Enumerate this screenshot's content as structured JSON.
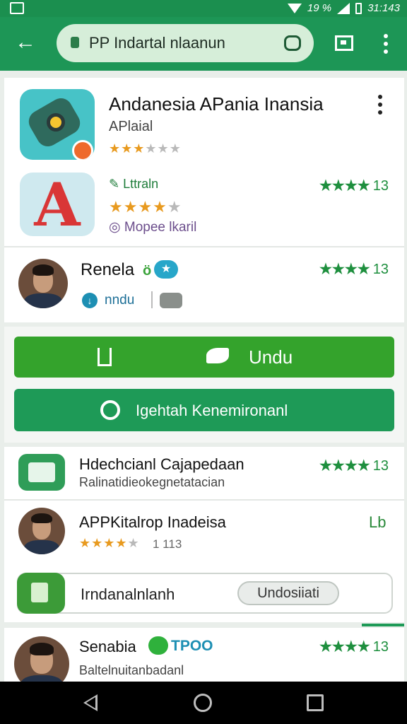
{
  "status_bar": {
    "time": "31:143",
    "battery_text": "19 %"
  },
  "app_bar": {
    "back_glyph": "←",
    "url": "PP Indartal nlaanun"
  },
  "app1": {
    "title": "Andanesia APania Inansia",
    "subtitle": "APlaial",
    "stars_on": "★★★",
    "stars_off": "★★★",
    "stars_fraction": 0.5
  },
  "app2": {
    "tag": "Lttraln",
    "letter": "A",
    "stars_on": "★★★★",
    "stars_off": "★",
    "rating_stars": "★★★★",
    "rating_num": "13",
    "publisher": "Mopee lkaril",
    "stars_fraction": 0.8
  },
  "developer": {
    "name": "Renela",
    "badge": "★",
    "sub_label": "nndu",
    "rating_stars": "★★★★",
    "rating_num": "13"
  },
  "actions": {
    "primary_label": "Undu",
    "secondary_label": "Igehtah Kenemironanl"
  },
  "list_item_1": {
    "title": "Hdechcianl Cajapedaan",
    "subtitle": "Ralinatidieokegnetatacian",
    "rating_stars": "★★★★",
    "rating_num": "13"
  },
  "list_item_2": {
    "title": "APPKitalrop Inadeisa",
    "stars_on": "★★★★",
    "stars_off": "★",
    "count": "1 113",
    "right_label": "Lb"
  },
  "install_chip": {
    "label": "Irndanalnlanh",
    "button": "Undosiiati"
  },
  "list_item_3": {
    "title": "Senabia",
    "tag": "TPOO",
    "subtitle": "Baltelnuitanbadanl",
    "rating_stars": "★★★★",
    "rating_num": "13"
  },
  "colors": {
    "brand_green": "#1d9656",
    "button_green": "#34a32c",
    "star_orange": "#e89a1f",
    "rating_green": "#1e8f3e"
  }
}
